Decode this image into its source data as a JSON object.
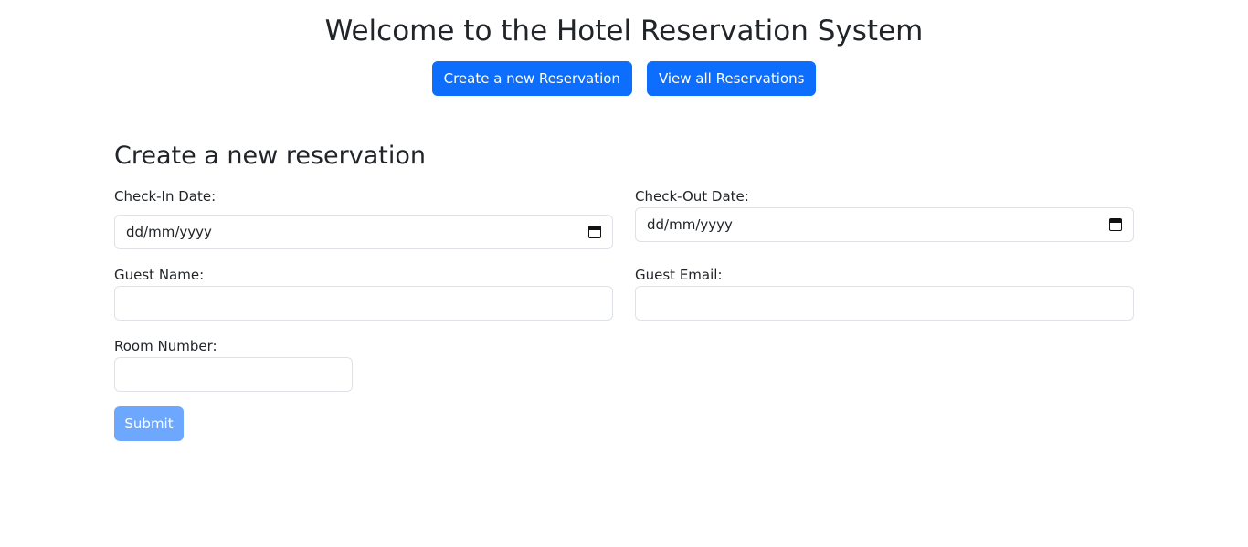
{
  "header": {
    "title": "Welcome to the Hotel Reservation System",
    "nav": {
      "create_label": "Create a new Reservation",
      "view_label": "View all Reservations"
    }
  },
  "form": {
    "title": "Create a new reservation",
    "check_in": {
      "label": "Check-In Date:",
      "value": "dd/mm/yyyy",
      "icon": "calendar-icon"
    },
    "check_out": {
      "label": "Check-Out Date:",
      "value": "dd/mm/yyyy",
      "icon": "calendar-icon"
    },
    "guest_name": {
      "label": "Guest Name:",
      "value": ""
    },
    "guest_email": {
      "label": "Guest Email:",
      "value": ""
    },
    "room_number": {
      "label": "Room Number:",
      "value": ""
    },
    "submit_label": "Submit",
    "submit_disabled": true
  },
  "colors": {
    "primary": "#0d6efd",
    "primary_disabled": "#6ea8fe",
    "text": "#212529",
    "border": "#dee2e6"
  }
}
